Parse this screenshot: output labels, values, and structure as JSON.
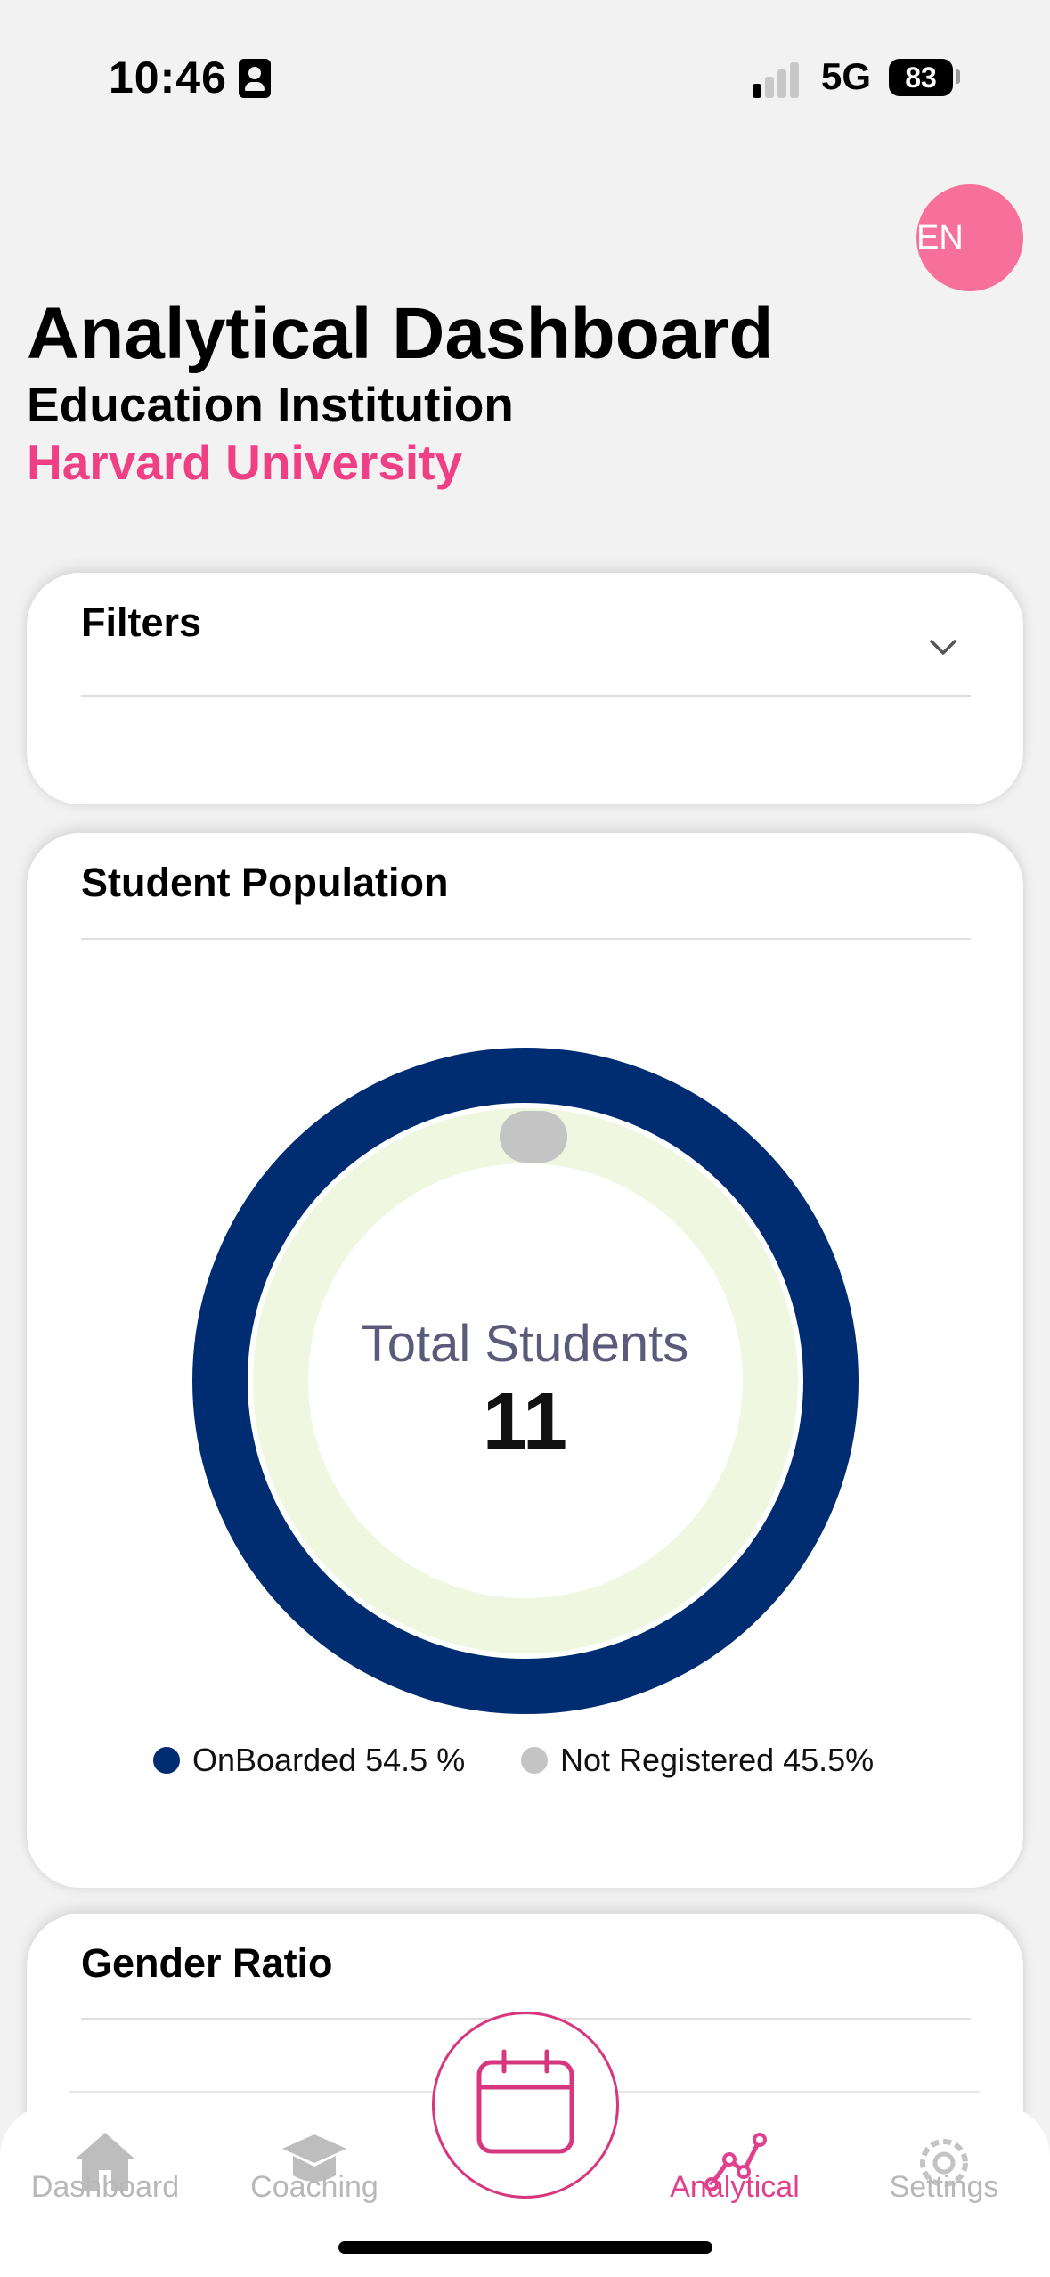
{
  "status_bar": {
    "time": "10:46",
    "network": "5G",
    "battery": "83"
  },
  "language_button": {
    "label": "EN"
  },
  "header": {
    "title": "Analytical Dashboard",
    "subtitle": "Education Institution",
    "institution": "Harvard University"
  },
  "filters": {
    "title": "Filters",
    "expand_icon": "chevron-down-icon"
  },
  "student_population": {
    "title": "Student Population",
    "center_label": "Total Students",
    "total": "11",
    "legend": [
      {
        "label": "OnBoarded 54.5 %",
        "color": "#002d72"
      },
      {
        "label": "Not Registered 45.5%",
        "color": "#c4c4c4"
      }
    ]
  },
  "chart_data": {
    "type": "pie",
    "title": "Student Population",
    "categories": [
      "OnBoarded",
      "Not Registered"
    ],
    "values": [
      54.5,
      45.5
    ],
    "colors": [
      "#002d72",
      "#c4c4c4"
    ],
    "center_text": "Total Students",
    "total": 11
  },
  "gender_ratio": {
    "title": "Gender Ratio"
  },
  "tabbar": {
    "tabs": [
      {
        "label": "Dashboard",
        "icon": "home-icon"
      },
      {
        "label": "Coaching",
        "icon": "graduation-cap-icon"
      },
      {
        "label": "Analytical",
        "icon": "analytics-icon",
        "active": true
      },
      {
        "label": "Settings",
        "icon": "gear-icon"
      }
    ],
    "center_button_icon": "calendar-icon",
    "accent_color": "#e0418c"
  }
}
